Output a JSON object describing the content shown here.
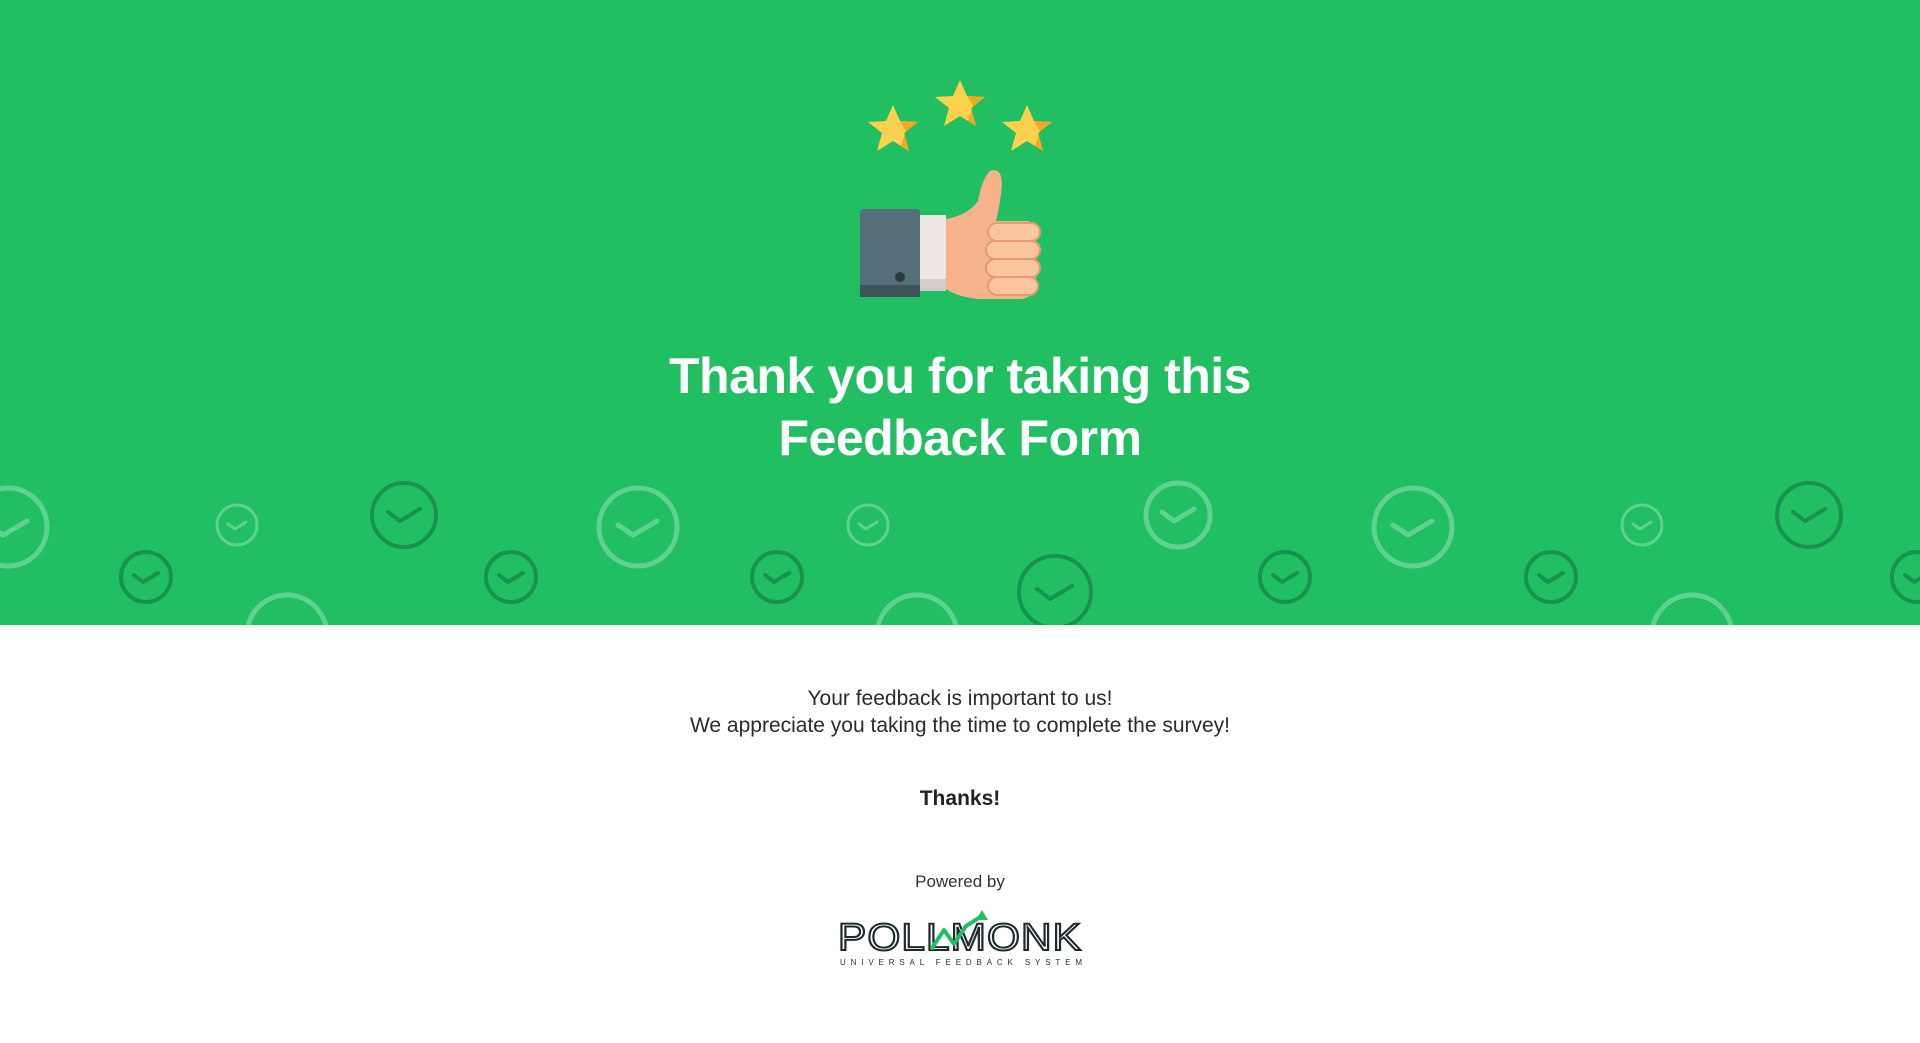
{
  "hero": {
    "title_line1": "Thank you for taking this",
    "title_line2": "Feedback Form",
    "background_color": "#22be62",
    "illustration_icon": "thumbs-up-with-stars-icon",
    "pattern_icon": "check-circle-icon"
  },
  "content": {
    "message_line1": "Your feedback is important to us!",
    "message_line2": "We appreciate you taking the time to complete the survey!",
    "thanks": "Thanks!"
  },
  "footer": {
    "powered_by": "Powered by",
    "logo_text": "POLLMONK",
    "logo_tagline": "UNIVERSAL FEEDBACK SYSTEM",
    "logo_accent_color": "#22be62"
  }
}
